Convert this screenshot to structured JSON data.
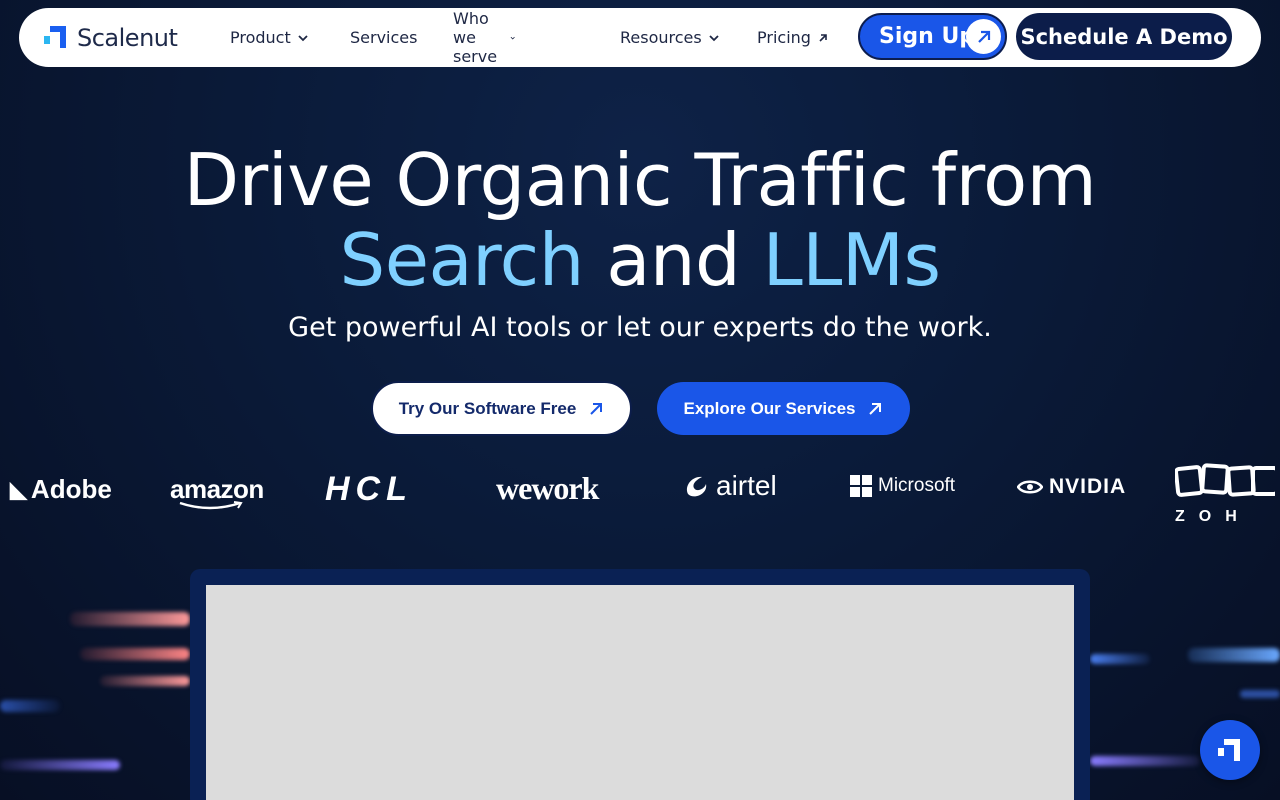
{
  "brand": {
    "name": "Scalenut"
  },
  "nav": {
    "items": [
      {
        "label": "Product",
        "dropdown": true
      },
      {
        "label": "Services"
      },
      {
        "label": "Who we serve",
        "dropdown": true
      },
      {
        "label": "Resources",
        "dropdown": true
      },
      {
        "label": "Pricing",
        "external": true
      }
    ],
    "signup_label": "Sign Up",
    "demo_label": "Schedule A Demo"
  },
  "hero": {
    "line1": "Drive Organic Traffic from",
    "line2_a": "Search",
    "line2_b": " and ",
    "line2_c": "LLMs",
    "subtitle": "Get powerful AI tools or let our experts do the work."
  },
  "cta": {
    "primary_label": "Try Our Software Free",
    "secondary_label": "Explore Our Services"
  },
  "logos": [
    "Adobe",
    "amazon",
    "HCL",
    "wework",
    "airtel",
    "Microsoft",
    "NVIDIA",
    "ZOH"
  ],
  "colors": {
    "accent_blue": "#1a56e8",
    "highlight": "#7fd0ff",
    "navy": "#0c1d4a"
  },
  "icons": {
    "chevron": "chevron-down-icon",
    "arrow": "arrow-up-right-icon",
    "chat": "chat-widget-icon"
  }
}
